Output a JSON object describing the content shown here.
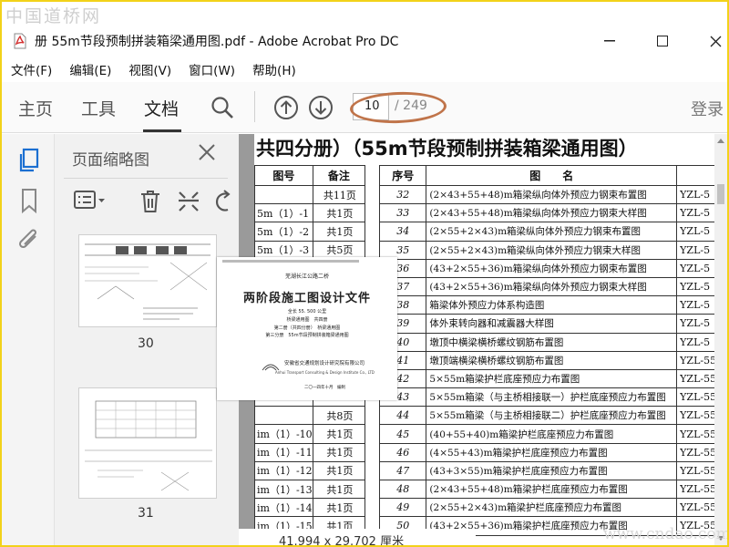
{
  "watermark_top": "中国道桥网",
  "watermark_bottom": "www.cndao.com",
  "window": {
    "title": "册 55m节段预制拼装箱梁通用图.pdf - Adobe Acrobat Pro DC",
    "min_glyph": "—",
    "max_glyph": "☐",
    "close_glyph": "✕"
  },
  "menu": [
    "文件(F)",
    "编辑(E)",
    "视图(V)",
    "窗口(W)",
    "帮助(H)"
  ],
  "toolbar": {
    "tabs": [
      "主页",
      "工具",
      "文档"
    ],
    "active_tab": "文档",
    "page_number": "10",
    "page_total": "/ 249",
    "login": "登录"
  },
  "panel": {
    "title": "页面缩略图",
    "close_glyph": "✕",
    "thumbnails": [
      {
        "label": "30"
      },
      {
        "label": "31"
      }
    ]
  },
  "cover": {
    "top_line": "芜湖长江公路二桥",
    "title": "两阶段施工图设计文件",
    "line1": "全长 55. 500 公里",
    "line2": "桥梁通用图　共四册",
    "line3": "第二册（共四分册）　桥梁通用图",
    "line4": "第三分册　55m节段预制拼装箱梁通用图",
    "org": "安徽省交通规划设计研究院有限公司",
    "org_en": "Anhui Transport Consulting & Design Institute Co., LTD",
    "date": "二〇一四年十月　编制"
  },
  "document": {
    "heading": "共四分册）（55m节段预制拼装箱梁通用图）",
    "left_table": {
      "headers": [
        "图号",
        "备注"
      ],
      "rows": [
        [
          "",
          "共11页"
        ],
        [
          "5m（1）-1",
          "共1页"
        ],
        [
          "5m（1）-2",
          "共1页"
        ],
        [
          "5m（1）-3",
          "共5页"
        ],
        [
          "",
          ""
        ],
        [
          "",
          ""
        ],
        [
          "",
          ""
        ],
        [
          "",
          ""
        ],
        [
          "",
          ""
        ],
        [
          "",
          ""
        ],
        [
          "",
          ""
        ],
        [
          "",
          ""
        ],
        [
          "",
          "共8页"
        ],
        [
          "im（1）-10",
          "共1页"
        ],
        [
          "im（1）-11",
          "共1页"
        ],
        [
          "im（1）-12",
          "共1页"
        ],
        [
          "im（1）-13",
          "共1页"
        ],
        [
          "im（1）-14",
          "共1页"
        ],
        [
          "im（1）-15",
          "共1页"
        ],
        [
          "im（1）-16",
          "共1页"
        ]
      ]
    },
    "right_table": {
      "headers": [
        "序号",
        "图　　名",
        ""
      ],
      "rows": [
        [
          "32",
          "(2×43+55+48)m箱梁纵向体外预应力钢束布置图",
          "YZL-5"
        ],
        [
          "33",
          "(2×43+55+48)m箱梁纵向体外预应力钢束大样图",
          "YZL-5"
        ],
        [
          "34",
          "(2×55+2×43)m箱梁纵向体外预应力钢束布置图",
          "YZL-5"
        ],
        [
          "35",
          "(2×55+2×43)m箱梁纵向体外预应力钢束大样图",
          "YZL-5"
        ],
        [
          "36",
          "(43+2×55+36)m箱梁纵向体外预应力钢束布置图",
          "YZL-5"
        ],
        [
          "37",
          "(43+2×55+36)m箱梁纵向体外预应力钢束大样图",
          "YZL-5"
        ],
        [
          "38",
          "箱梁体外预应力体系构造图",
          "YZL-5"
        ],
        [
          "39",
          "体外束转向器和减震器大样图",
          "YZL-5"
        ],
        [
          "40",
          "墩顶中横梁横桥螺纹钢筋布置图",
          "YZL-5"
        ],
        [
          "41",
          "墩顶端横梁横桥螺纹钢筋布置图",
          "YZL-55"
        ],
        [
          "42",
          "5×55m箱梁护栏底座预应力布置图",
          "YZL-55"
        ],
        [
          "43",
          "5×55m箱梁（与主桥相接联一）护栏底座预应力布置图",
          "YZL-55"
        ],
        [
          "44",
          "5×55m箱梁（与主桥相接联二）护栏底座预应力布置图",
          "YZL-55"
        ],
        [
          "45",
          "(40+55+40)m箱梁护栏底座预应力布置图",
          "YZL-55"
        ],
        [
          "46",
          "(4×55+43)m箱梁护栏底座预应力布置图",
          "YZL-55"
        ],
        [
          "47",
          "(43+3×55)m箱梁护栏底座预应力布置图",
          "YZL-55"
        ],
        [
          "48",
          "(2×43+55+48)m箱梁护栏底座预应力布置图",
          "YZL-55"
        ],
        [
          "49",
          "(2×55+2×43)m箱梁护栏底座预应力布置图",
          "YZL-55"
        ],
        [
          "50",
          "(43+2×55+36)m箱梁护栏底座预应力布置图",
          "YZL-55"
        ]
      ]
    }
  },
  "status": {
    "size": "41.994 x 29.702 厘米"
  },
  "colors": {
    "frame_border": "#f2d21a",
    "annotation_circle": "#c0744a",
    "pdf_red": "#d32f2f"
  },
  "icons": [
    "pdf-icon",
    "search-icon",
    "page-up-icon",
    "page-down-icon",
    "thumbnails-icon",
    "bookmark-icon",
    "attachment-icon",
    "options-icon",
    "delete-icon",
    "extract-icon",
    "rotate-icon"
  ]
}
